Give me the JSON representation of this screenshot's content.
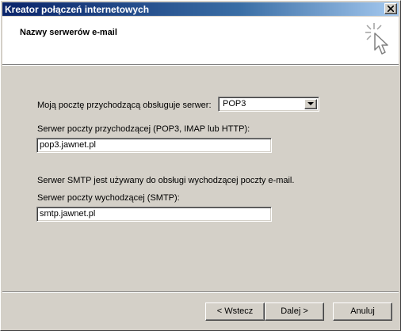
{
  "window": {
    "title": "Kreator połączeń internetowych",
    "close_icon": "close-x-icon"
  },
  "header": {
    "title": "Nazwy serwerów e-mail",
    "icon": "wizard-cursor-sparkle-icon"
  },
  "form": {
    "incoming_type_label": "Moją pocztę przychodzącą obsługuje serwer:",
    "incoming_type_value": "POP3",
    "incoming_server_label": "Serwer poczty przychodzącej (POP3, IMAP lub HTTP):",
    "incoming_server_value": "pop3.jawnet.pl",
    "smtp_info": "Serwer SMTP jest używany do obsługi wychodzącej poczty e-mail.",
    "outgoing_server_label": "Serwer poczty wychodzącej (SMTP):",
    "outgoing_server_value": "smtp.jawnet.pl"
  },
  "buttons": {
    "back": "< Wstecz",
    "next": "Dalej >",
    "cancel": "Anuluj"
  }
}
